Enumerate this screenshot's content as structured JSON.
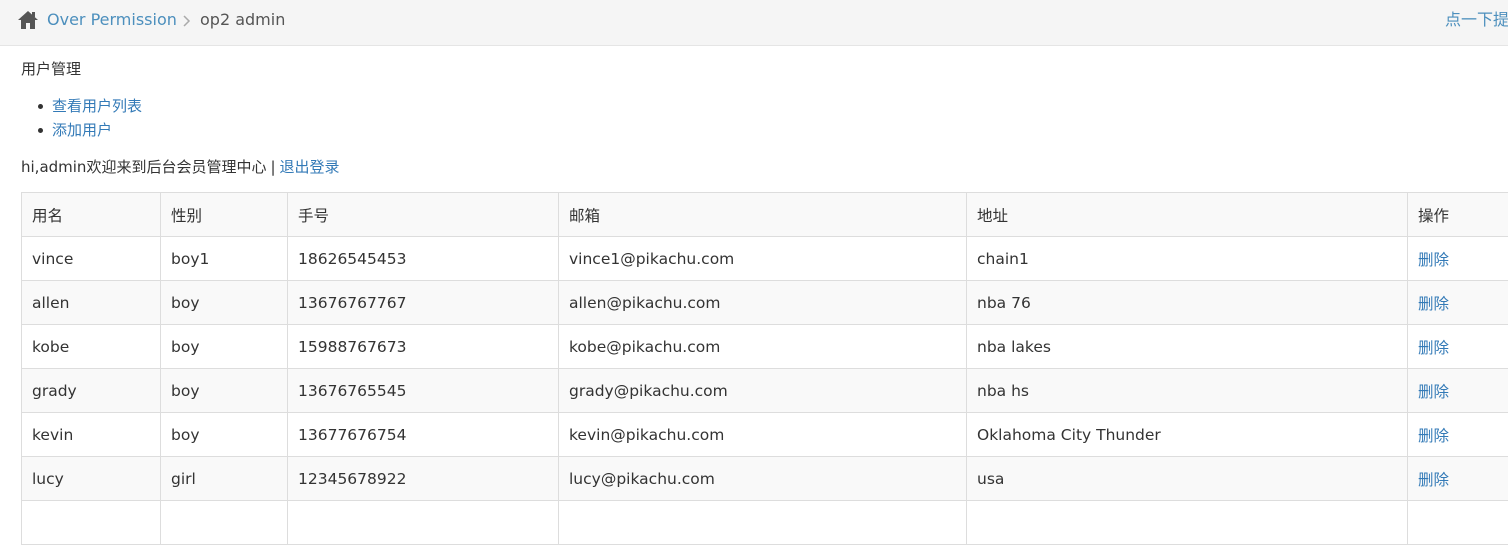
{
  "breadcrumb": {
    "home_icon": "home-icon",
    "parent_label": "Over Permission",
    "separator_icon": "chevron-right-icon",
    "current_label": "op2 admin",
    "hint_label": "点一下提"
  },
  "section": {
    "title": "用户管理",
    "menu": [
      {
        "label": "查看用户列表"
      },
      {
        "label": "添加用户"
      }
    ]
  },
  "welcome": {
    "text": "hi,admin欢迎来到后台会员管理中心",
    "divider": "|",
    "logout_label": "退出登录"
  },
  "table": {
    "headers": [
      "用名",
      "性别",
      "手号",
      "邮箱",
      "地址",
      "操作"
    ],
    "rows": [
      {
        "name": "vince",
        "sex": "boy1",
        "phone": "18626545453",
        "email": "vince1@pikachu.com",
        "address": "chain1",
        "action": "删除"
      },
      {
        "name": "allen",
        "sex": "boy",
        "phone": "13676767767",
        "email": "allen@pikachu.com",
        "address": "nba 76",
        "action": "删除"
      },
      {
        "name": "kobe",
        "sex": "boy",
        "phone": "15988767673",
        "email": "kobe@pikachu.com",
        "address": "nba lakes",
        "action": "删除"
      },
      {
        "name": "grady",
        "sex": "boy",
        "phone": "13676765545",
        "email": "grady@pikachu.com",
        "address": "nba hs",
        "action": "删除"
      },
      {
        "name": "kevin",
        "sex": "boy",
        "phone": "13677676754",
        "email": "kevin@pikachu.com",
        "address": "Oklahoma City Thunder",
        "action": "删除"
      },
      {
        "name": "lucy",
        "sex": "girl",
        "phone": "12345678922",
        "email": "lucy@pikachu.com",
        "address": "usa",
        "action": "删除"
      }
    ]
  }
}
